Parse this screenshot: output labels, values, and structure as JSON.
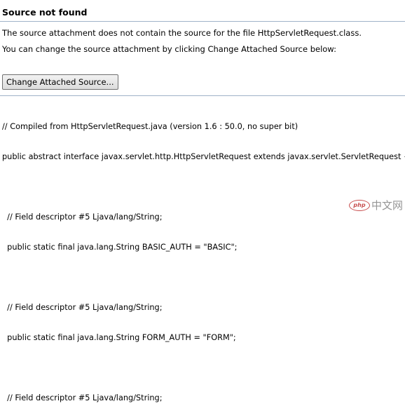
{
  "header": {
    "title": "Source not found"
  },
  "messages": [
    "The source attachment does not contain the source for the file HttpServletRequest.class.",
    "You can change the source attachment by clicking Change Attached Source below:"
  ],
  "button": {
    "label": "Change Attached Source..."
  },
  "code_lines": [
    "// Compiled from HttpServletRequest.java (version 1.6 : 50.0, no super bit)",
    "public abstract interface javax.servlet.http.HttpServletRequest extends javax.servlet.ServletRequest {",
    "",
    "  // Field descriptor #5 Ljava/lang/String;",
    "  public static final java.lang.String BASIC_AUTH = \"BASIC\";",
    "",
    "  // Field descriptor #5 Ljava/lang/String;",
    "  public static final java.lang.String FORM_AUTH = \"FORM\";",
    "",
    "  // Field descriptor #5 Ljava/lang/String;"
  ],
  "watermark": {
    "logo": "php",
    "text": "中文网"
  }
}
